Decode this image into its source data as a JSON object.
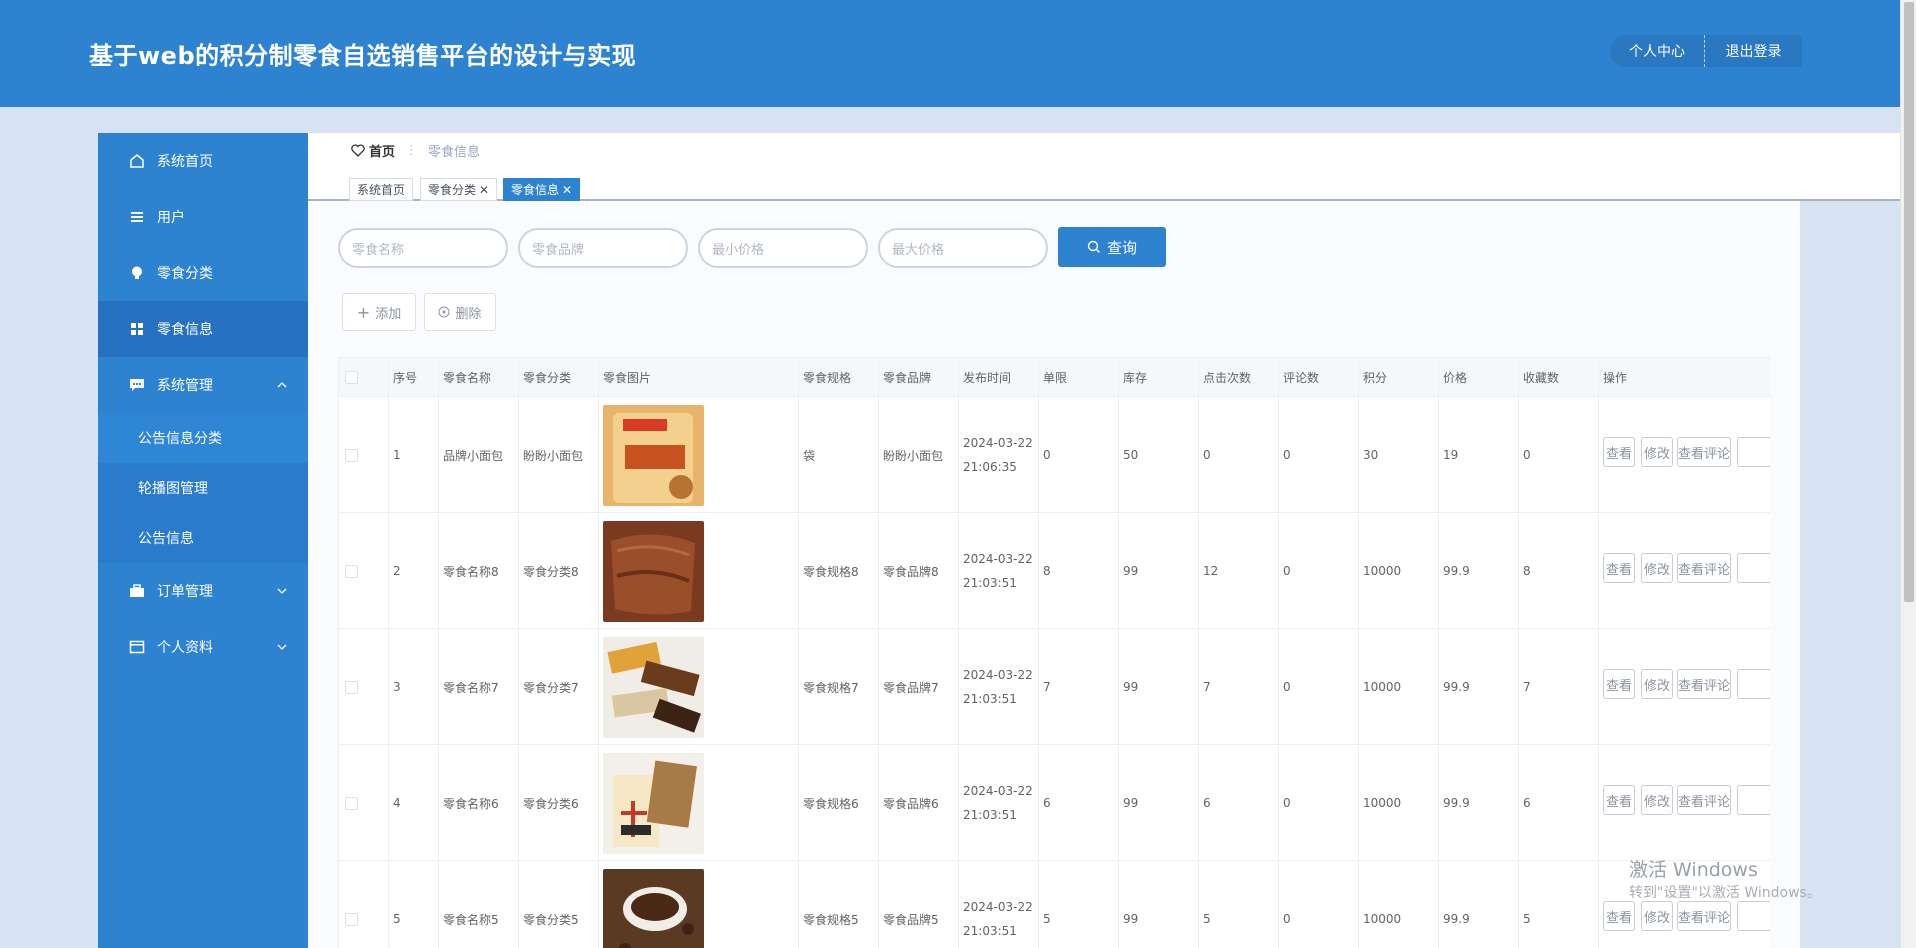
{
  "header": {
    "title": "基于web的积分制零食自选销售平台的设计与实现",
    "personal_center": "个人中心",
    "logout": "退出登录"
  },
  "sidebar": {
    "items": [
      {
        "label": "系统首页",
        "icon": "home-icon"
      },
      {
        "label": "用户",
        "icon": "list-icon"
      },
      {
        "label": "零食分类",
        "icon": "bulb-icon"
      },
      {
        "label": "零食信息",
        "icon": "grid-icon"
      },
      {
        "label": "系统管理",
        "icon": "chat-icon"
      },
      {
        "label": "订单管理",
        "icon": "briefcase-icon"
      },
      {
        "label": "个人资料",
        "icon": "card-icon"
      }
    ],
    "sub_items": [
      "公告信息分类",
      "轮播图管理",
      "公告信息"
    ]
  },
  "breadcrumb": {
    "home": "首页",
    "current": "零食信息"
  },
  "tags": [
    "系统首页",
    "零食分类",
    "零食信息"
  ],
  "search": {
    "name_placeholder": "零食名称",
    "brand_placeholder": "零食品牌",
    "min_price_placeholder": "最小价格",
    "max_price_placeholder": "最大价格",
    "query_label": "查询"
  },
  "actions": {
    "add": "添加",
    "delete": "删除"
  },
  "table": {
    "columns": [
      "序号",
      "零食名称",
      "零食分类",
      "零食图片",
      "零食规格",
      "零食品牌",
      "发布时间",
      "单限",
      "库存",
      "点击次数",
      "评论数",
      "积分",
      "价格",
      "收藏数",
      "操作"
    ],
    "rows": [
      {
        "idx": "1",
        "name": "品牌小面包",
        "category": "盼盼小面包",
        "spec": "袋",
        "brand": "盼盼小面包",
        "date": "2024-03-22",
        "time": "21:06:35",
        "limit": "0",
        "stock": "50",
        "clicks": "0",
        "comments": "0",
        "points": "30",
        "price": "19",
        "favorites": "0"
      },
      {
        "idx": "2",
        "name": "零食名称8",
        "category": "零食分类8",
        "spec": "零食规格8",
        "brand": "零食品牌8",
        "date": "2024-03-22",
        "time": "21:03:51",
        "limit": "8",
        "stock": "99",
        "clicks": "12",
        "comments": "0",
        "points": "10000",
        "price": "99.9",
        "favorites": "8"
      },
      {
        "idx": "3",
        "name": "零食名称7",
        "category": "零食分类7",
        "spec": "零食规格7",
        "brand": "零食品牌7",
        "date": "2024-03-22",
        "time": "21:03:51",
        "limit": "7",
        "stock": "99",
        "clicks": "7",
        "comments": "0",
        "points": "10000",
        "price": "99.9",
        "favorites": "7"
      },
      {
        "idx": "4",
        "name": "零食名称6",
        "category": "零食分类6",
        "spec": "零食规格6",
        "brand": "零食品牌6",
        "date": "2024-03-22",
        "time": "21:03:51",
        "limit": "6",
        "stock": "99",
        "clicks": "6",
        "comments": "0",
        "points": "10000",
        "price": "99.9",
        "favorites": "6"
      },
      {
        "idx": "5",
        "name": "零食名称5",
        "category": "零食分类5",
        "spec": "零食规格5",
        "brand": "零食品牌5",
        "date": "2024-03-22",
        "time": "21:03:51",
        "limit": "5",
        "stock": "99",
        "clicks": "5",
        "comments": "0",
        "points": "10000",
        "price": "99.9",
        "favorites": "5"
      }
    ],
    "op_view": "查看",
    "op_edit": "修改",
    "op_comments": "查看评论"
  },
  "watermark": {
    "line1": "激活 Windows",
    "line2": "转到\"设置\"以激活 Windows。"
  },
  "colors": {
    "primary": "#2e83d1",
    "sidebar_active": "#2672c0",
    "page_bg": "#d7e2f2"
  }
}
